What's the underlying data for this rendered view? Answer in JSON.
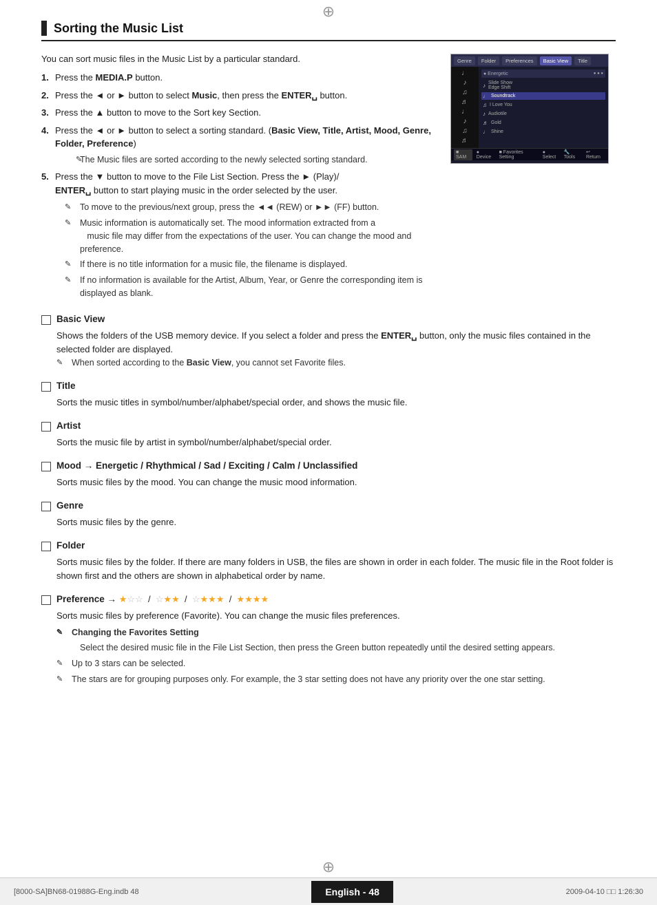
{
  "page": {
    "reg_mark": "⊕",
    "section_title": "Sorting the Music List",
    "intro_text": "You can sort music files in the Music List by a particular standard.",
    "steps": [
      {
        "num": "1.",
        "text": "Press the ",
        "bold": "MEDIA.P",
        "after": " button."
      },
      {
        "num": "2.",
        "text": "Press the ◄ or ► button to select ",
        "bold": "Music",
        "after": ", then press the ",
        "bold2": "ENTER",
        "after2": " button."
      },
      {
        "num": "3.",
        "text": "Press the ▲ button to move to the Sort key Section."
      },
      {
        "num": "4.",
        "text": "Press the ◄ or ► button to select a sorting standard. (",
        "bold": "Basic View, Title, Artist, Mood, Genre, Folder, Preference",
        "after": ")"
      },
      {
        "num": "note",
        "text": "The Music files are sorted according to the newly selected sorting standard."
      },
      {
        "num": "5.",
        "text": "Press the ▼ button to move to the File List Section. Press the ► (Play)/ ENTER button to start playing music in the order selected by the user."
      }
    ],
    "step5_notes": [
      "To move to the previous/next group, press the ◄◄ (REW) or ►► (FF) button.",
      "Music information is automatically set. The mood information extracted from a music file may differ from the expectations of the user. You can change the mood and preference.",
      "If there is no title information for a music file, the filename is displayed.",
      "If no information is available for the Artist, Album, Year, or Genre the corresponding item is displayed as blank."
    ],
    "subsections": [
      {
        "id": "basic-view",
        "title": "Basic View",
        "body": "Shows the folders of the USB memory device. If you select a folder and press the ",
        "bold_inline": "ENTER",
        "body_after": " button, only the music files contained in the selected folder are displayed.",
        "notes": [
          "When sorted according to the Basic View, you cannot set Favorite files."
        ]
      },
      {
        "id": "title",
        "title": "Title",
        "body": "Sorts the music titles in symbol/number/alphabet/special order, and shows the music file.",
        "notes": []
      },
      {
        "id": "artist",
        "title": "Artist",
        "body": "Sorts the music file by artist in symbol/number/alphabet/special order.",
        "notes": []
      },
      {
        "id": "mood",
        "title": "Mood → Energetic / Rhythmical / Sad / Exciting / Calm / Unclassified",
        "body": "Sorts music files by the mood. You can change the music mood information.",
        "notes": []
      },
      {
        "id": "genre",
        "title": "Genre",
        "body": "Sorts music files by the genre.",
        "notes": []
      },
      {
        "id": "folder",
        "title": "Folder",
        "body": "Sorts music files by the folder. If there are many folders in USB, the files are shown in order in each folder. The music file in the Root folder is shown first and the others are shown in alphabetical order by name.",
        "notes": []
      },
      {
        "id": "preference",
        "title": "Preference →",
        "stars_label": "★☆☆ / ☆★★ / ☆★★★ / ★★★★",
        "body": "Sorts music files by preference (Favorite). You can change the music files preferences.",
        "notes": [
          "Changing the Favorites Setting",
          "Select the desired music file in the File List Section, then press the Green button repeatedly until the desired setting appears.",
          "Up to 3 stars can be selected.",
          "The stars are for grouping purposes only. For example, the 3 star setting does not have any priority over the one star setting."
        ],
        "note_types": [
          "header",
          "body",
          "note",
          "note"
        ]
      }
    ],
    "footer": {
      "left": "[8000-SA]BN68-01988G-Eng.indb   48",
      "page_label": "English - 48",
      "right": "2009-04-10   □□ 1:26:30"
    }
  }
}
